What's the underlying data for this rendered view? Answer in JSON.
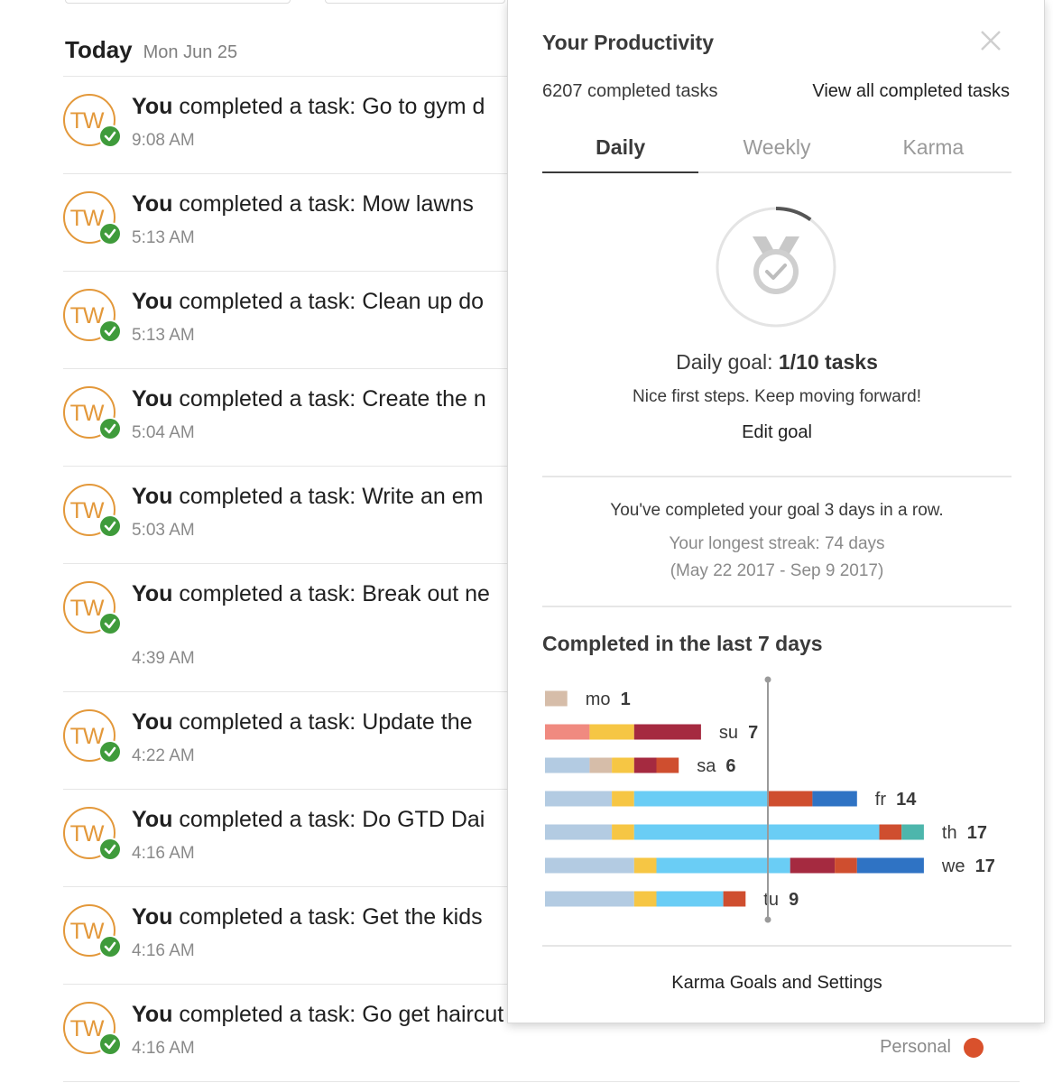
{
  "day": {
    "title": "Today",
    "date": "Mon Jun 25"
  },
  "avatar_initials": "TW",
  "prefix_strong": "You",
  "prefix_rest": " completed a task: ",
  "items": [
    {
      "task": "Go to gym d",
      "time": "9:08 AM"
    },
    {
      "task": "Mow lawns",
      "time": "5:13 AM"
    },
    {
      "task": "Clean up do",
      "time": "5:13 AM"
    },
    {
      "task": "Create the n",
      "time": "5:04 AM"
    },
    {
      "task": "Write an em",
      "time": "5:03 AM"
    },
    {
      "task": "Break out ne",
      "time": "4:39 AM"
    },
    {
      "task": "Update the",
      "time": "4:22 AM"
    },
    {
      "task": "Do GTD Dai",
      "time": "4:16 AM"
    },
    {
      "task": "Get the kids",
      "time": "4:16 AM"
    },
    {
      "task": "Go get haircut",
      "time": "4:16 AM",
      "project": "Personal"
    }
  ],
  "colors": {
    "avatar": "#e3983a",
    "check": "#3f9b3b",
    "personal_project": "#d9512c"
  },
  "popup": {
    "title": "Your Productivity",
    "completed_count": "6207 completed tasks",
    "view_all": "View all completed tasks",
    "tabs": [
      "Daily",
      "Weekly",
      "Karma"
    ],
    "active_tab": "Daily",
    "goal_label": "Daily goal: ",
    "goal_value": "1/10 tasks",
    "goal_progress": 0.1,
    "goal_message": "Nice first steps. Keep moving forward!",
    "edit_goal": "Edit goal",
    "streak": "You've completed your goal 3 days in a row.",
    "longest_streak": "Your longest streak: 74 days",
    "longest_range": "(May 22 2017 - Sep 9 2017)",
    "chart_title": "Completed in the last 7 days",
    "settings_link": "Karma Goals and Settings"
  },
  "chart_data": {
    "type": "bar",
    "orientation": "horizontal",
    "stacked": true,
    "goal_line": 10,
    "categories": [
      "mo",
      "su",
      "sa",
      "fr",
      "th",
      "we",
      "tu"
    ],
    "values": [
      1,
      7,
      6,
      14,
      17,
      17,
      9
    ],
    "segments": [
      [
        {
          "color": "#d6bda9",
          "value": 1
        }
      ],
      [
        {
          "color": "#f08a80",
          "value": 2
        },
        {
          "color": "#f6c644",
          "value": 2
        },
        {
          "color": "#a52a40",
          "value": 3
        }
      ],
      [
        {
          "color": "#b3cbe2",
          "value": 2
        },
        {
          "color": "#d6bda9",
          "value": 1
        },
        {
          "color": "#f6c644",
          "value": 1
        },
        {
          "color": "#a52a40",
          "value": 1
        },
        {
          "color": "#cf4e2f",
          "value": 1
        }
      ],
      [
        {
          "color": "#b3cbe2",
          "value": 3
        },
        {
          "color": "#f6c644",
          "value": 1
        },
        {
          "color": "#6acdf5",
          "value": 6
        },
        {
          "color": "#cf4e2f",
          "value": 2
        },
        {
          "color": "#2f73c4",
          "value": 2
        }
      ],
      [
        {
          "color": "#b3cbe2",
          "value": 3
        },
        {
          "color": "#f6c644",
          "value": 1
        },
        {
          "color": "#6acdf5",
          "value": 11
        },
        {
          "color": "#cf4e2f",
          "value": 1
        },
        {
          "color": "#4db6ac",
          "value": 1
        }
      ],
      [
        {
          "color": "#b3cbe2",
          "value": 4
        },
        {
          "color": "#f6c644",
          "value": 1
        },
        {
          "color": "#6acdf5",
          "value": 6
        },
        {
          "color": "#a52a40",
          "value": 2
        },
        {
          "color": "#cf4e2f",
          "value": 1
        },
        {
          "color": "#2f73c4",
          "value": 3
        }
      ],
      [
        {
          "color": "#b3cbe2",
          "value": 4
        },
        {
          "color": "#f6c644",
          "value": 1
        },
        {
          "color": "#6acdf5",
          "value": 3
        },
        {
          "color": "#cf4e2f",
          "value": 1
        }
      ]
    ]
  }
}
